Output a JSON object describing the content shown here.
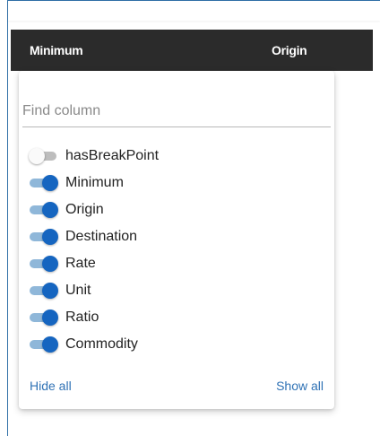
{
  "grid": {
    "columns": [
      {
        "label": "Minimum"
      },
      {
        "label": "Origin"
      }
    ]
  },
  "column_picker": {
    "search_placeholder": "Find column",
    "items": [
      {
        "label": "hasBreakPoint",
        "enabled": false
      },
      {
        "label": "Minimum",
        "enabled": true
      },
      {
        "label": "Origin",
        "enabled": true
      },
      {
        "label": "Destination",
        "enabled": true
      },
      {
        "label": "Rate",
        "enabled": true
      },
      {
        "label": "Unit",
        "enabled": true
      },
      {
        "label": "Ratio",
        "enabled": true
      },
      {
        "label": "Commodity",
        "enabled": true
      }
    ],
    "hide_all_label": "Hide all",
    "show_all_label": "Show all"
  },
  "colors": {
    "header_bg": "#2b2b2b",
    "toggle_on": "#1565c0",
    "toggle_track_on": "#8fb7d9",
    "link": "#2f72b5"
  }
}
